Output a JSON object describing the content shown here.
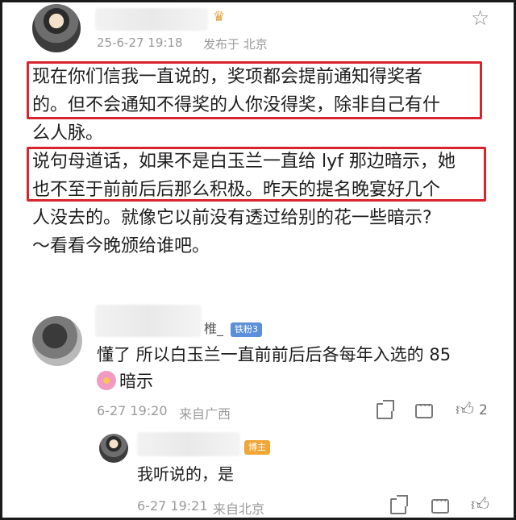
{
  "post": {
    "timestamp": "25-6-27 19:18",
    "location": "发布于 北京",
    "lines": [
      "现在你们信我一直说的，奖项都会提前通知得奖者",
      "的。但不会通知不得奖的人你没得奖，除非自己有什",
      "么人脉。",
      "说句母道话，如果不是白玉兰一直给 lyf 那边暗示，她",
      "也不至于前前后后那么积极。昨天的提名晚宴好几个",
      "人没去的。就像它以前没有透过给别的花一些暗示?",
      "～看看今晚颁给谁吧。"
    ]
  },
  "comment": {
    "name_tail": "椎_",
    "badge": "铁粉3",
    "text_line1": "懂了 所以白玉兰一直前前后后各每年入选的 85",
    "text_line2": "暗示",
    "timestamp": "6-27 19:20",
    "location": "来自广西",
    "like_count": "2"
  },
  "reply": {
    "badge": "博主",
    "text": "我听说的，是",
    "timestamp": "6-27 19:21",
    "location": "来自北京"
  },
  "colors": {
    "highlight": "#d9232e",
    "fan_badge": "#5b8fd9",
    "owner_badge": "#f0a637"
  }
}
